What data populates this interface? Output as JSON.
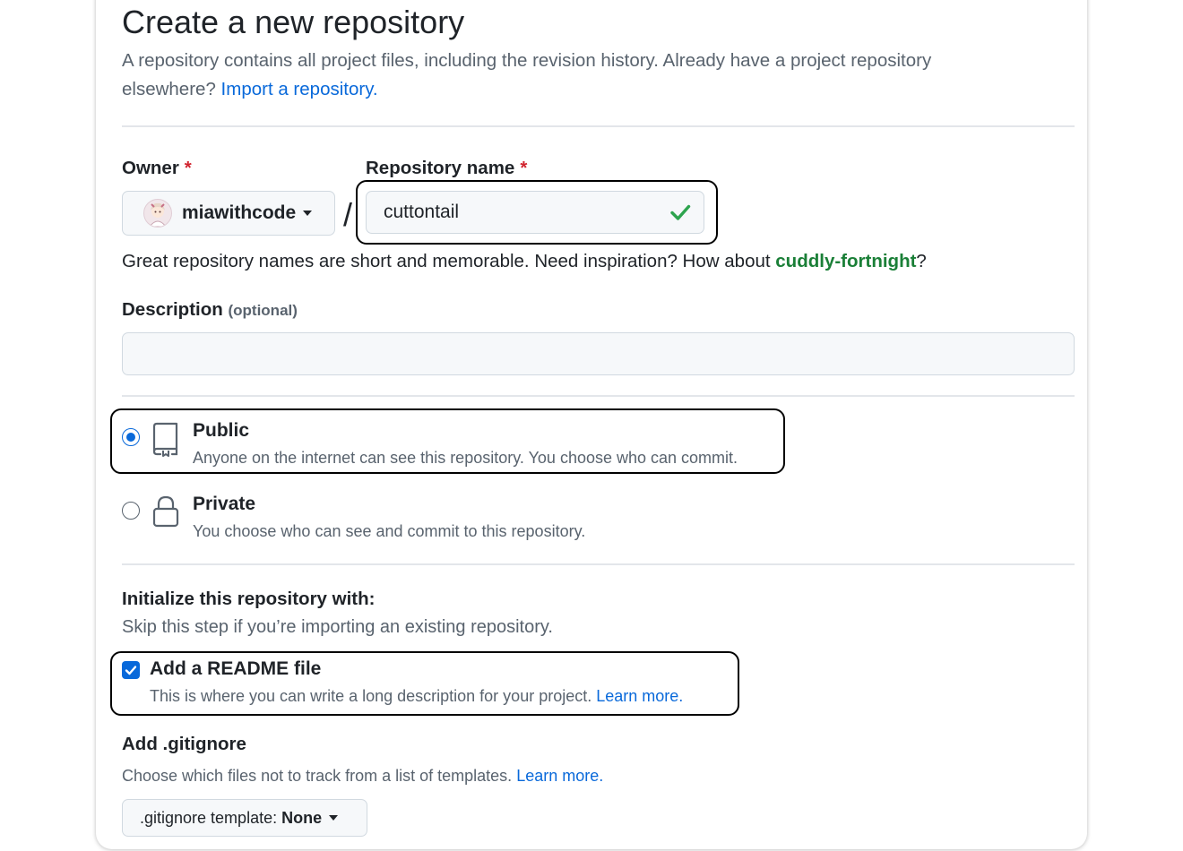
{
  "page": {
    "title": "Create a new repository",
    "subtitle_text": "A repository contains all project files, including the revision history. Already have a project repository elsewhere?",
    "import_link": "Import a repository."
  },
  "owner": {
    "label": "Owner",
    "required_mark": "*",
    "value": "miawithcode"
  },
  "separator": "/",
  "repo_name": {
    "label": "Repository name",
    "required_mark": "*",
    "value": "cuttontail",
    "valid_icon": "check-icon"
  },
  "name_hint": {
    "text": "Great repository names are short and memorable. Need inspiration? How about",
    "suggestion": "cuddly-fortnight",
    "suffix": "?"
  },
  "description": {
    "label": "Description",
    "optional": "(optional)",
    "value": ""
  },
  "visibility": {
    "public": {
      "title": "Public",
      "desc": "Anyone on the internet can see this repository. You choose who can commit.",
      "icon": "repo-icon",
      "selected": true
    },
    "private": {
      "title": "Private",
      "desc": "You choose who can see and commit to this repository.",
      "icon": "lock-icon",
      "selected": false
    }
  },
  "init": {
    "heading": "Initialize this repository with:",
    "subheading": "Skip this step if you’re importing an existing repository.",
    "readme": {
      "title": "Add a README file",
      "desc": "This is where you can write a long description for your project.",
      "learn_more": "Learn more.",
      "checked": true
    }
  },
  "gitignore": {
    "heading": "Add .gitignore",
    "desc": "Choose which files not to track from a list of templates.",
    "learn_more": "Learn more.",
    "select_prefix": ".gitignore template:",
    "select_value": "None"
  },
  "colors": {
    "accent": "#0969da",
    "success": "#1a7f37",
    "danger": "#d1242f",
    "check": "#2da44e"
  }
}
